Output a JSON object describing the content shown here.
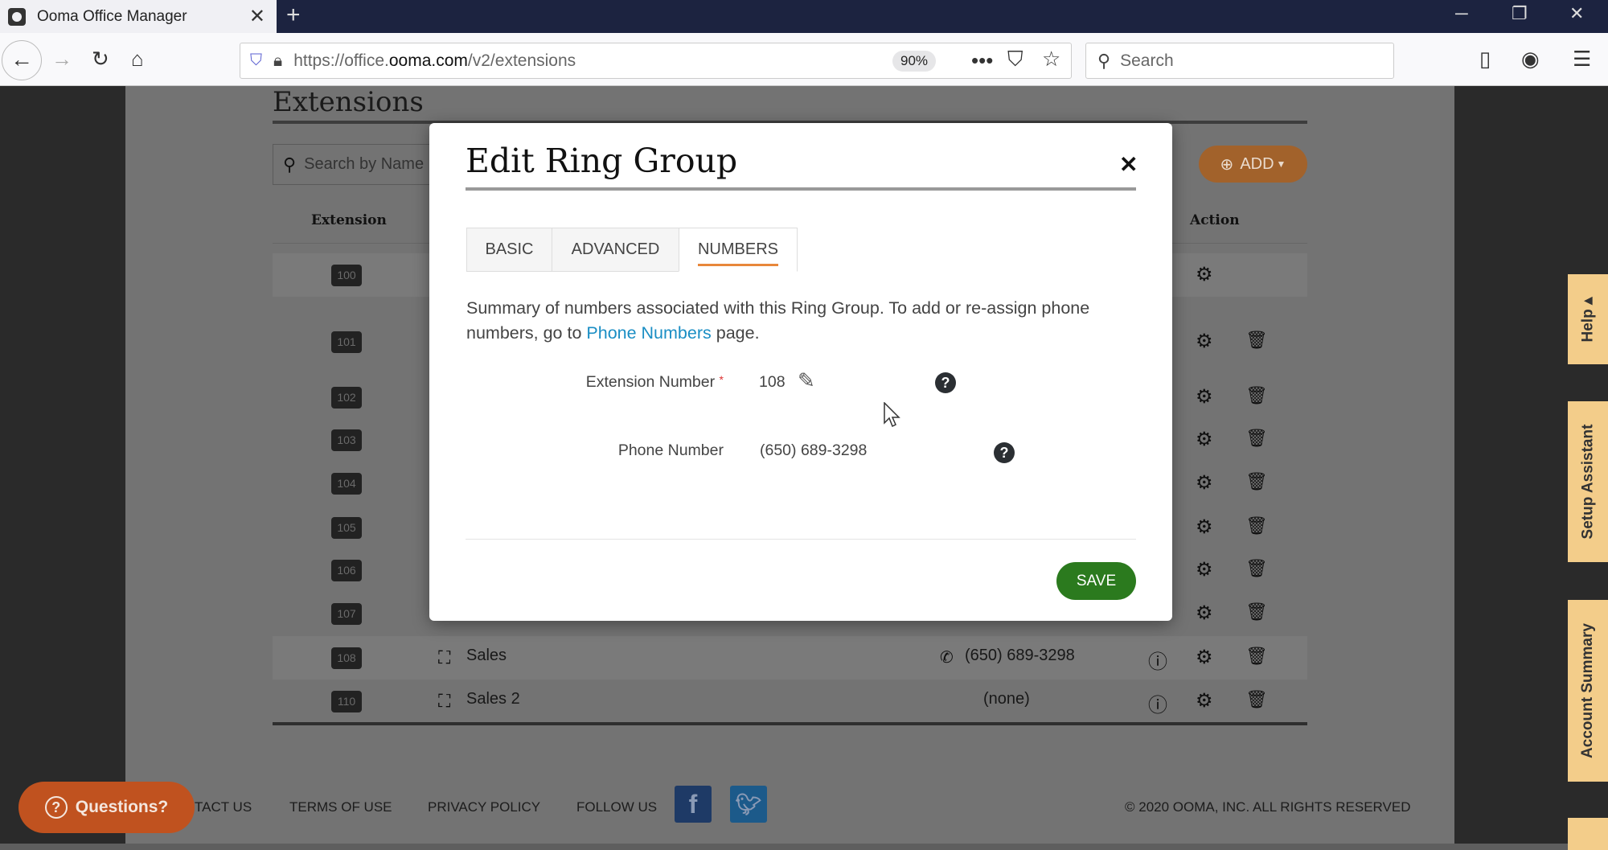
{
  "browser": {
    "tab_title": "Ooma Office Manager",
    "url_prefix": "https://office.",
    "url_host": "ooma.com",
    "url_path": "/v2/extensions",
    "zoom": "90%",
    "search_placeholder": "Search"
  },
  "page": {
    "title": "Extensions",
    "search_placeholder": "Search by Name",
    "add_label": "ADD",
    "col_extension": "Extension",
    "col_action": "Action",
    "rows": [
      {
        "ext": "100",
        "name": "",
        "number": ""
      },
      {
        "ext": "101",
        "name": "",
        "number": ""
      },
      {
        "ext": "102",
        "name": "",
        "number": ""
      },
      {
        "ext": "103",
        "name": "",
        "number": ""
      },
      {
        "ext": "104",
        "name": "",
        "number": ""
      },
      {
        "ext": "105",
        "name": "",
        "number": ""
      },
      {
        "ext": "106",
        "name": "",
        "number": ""
      },
      {
        "ext": "107",
        "name": "",
        "number": ""
      },
      {
        "ext": "108",
        "name": "Sales",
        "number": "(650) 689-3298"
      },
      {
        "ext": "110",
        "name": "Sales 2",
        "number": "(none)"
      }
    ]
  },
  "footer": {
    "contact": "TACT US",
    "terms": "TERMS OF USE",
    "privacy": "PRIVACY POLICY",
    "follow": "FOLLOW US",
    "facebook": "f",
    "copyright": "© 2020 OOMA, INC. ALL RIGHTS RESERVED",
    "questions": "Questions?"
  },
  "side_tabs": {
    "help": "Help ▴",
    "setup": "Setup Assistant",
    "account": "Account Summary"
  },
  "modal": {
    "title": "Edit Ring Group",
    "tabs": [
      "BASIC",
      "ADVANCED",
      "NUMBERS"
    ],
    "active_tab": "NUMBERS",
    "summary_pre": "Summary of numbers associated with this Ring Group. To add or re-assign phone numbers, go to ",
    "summary_link": "Phone Numbers",
    "summary_post": " page.",
    "extension_label": "Extension Number",
    "required_mark": "*",
    "extension_value": "108",
    "phone_label": "Phone Number",
    "phone_value": "(650) 689-3298",
    "save_label": "SAVE"
  },
  "colors": {
    "accent": "#e8873a",
    "save": "#2b7a1e",
    "link": "#1a8ec4",
    "browser_tabbar": "#1c2340"
  }
}
